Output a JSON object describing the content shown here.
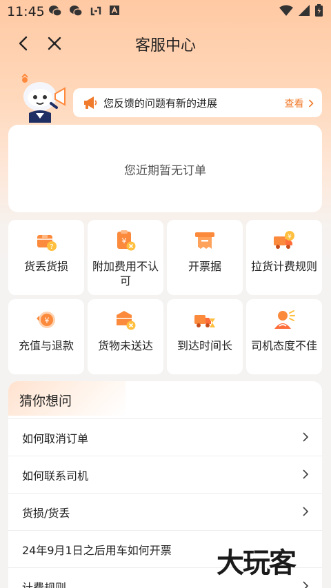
{
  "status_bar": {
    "time": "11:45"
  },
  "nav": {
    "title": "客服中心"
  },
  "notice": {
    "text": "您反馈的问题有新的进展",
    "link": "查看"
  },
  "orders": {
    "empty_text": "您近期暂无订单"
  },
  "services": [
    {
      "label": "货丢货损",
      "icon": "damaged-box-icon"
    },
    {
      "label": "附加费用不认可",
      "icon": "extra-fee-icon"
    },
    {
      "label": "开票据",
      "icon": "invoice-icon"
    },
    {
      "label": "拉货计费规则",
      "icon": "truck-fee-icon"
    },
    {
      "label": "充值与退款",
      "icon": "recharge-icon"
    },
    {
      "label": "货物未送达",
      "icon": "undelivered-box-icon"
    },
    {
      "label": "到达时间长",
      "icon": "truck-hourglass-icon"
    },
    {
      "label": "司机态度不佳",
      "icon": "driver-icon"
    }
  ],
  "faq": {
    "title": "猜你想问",
    "items": [
      "如何取消订单",
      "如何联系司机",
      "货损/货丢",
      "24年9月1日之后用车如何开票",
      "计费规则"
    ]
  },
  "watermark": "大玩客",
  "colors": {
    "accent": "#f07b2c",
    "header_bg": "#ffc9a3",
    "icon_orange": "#fb8a3c"
  }
}
